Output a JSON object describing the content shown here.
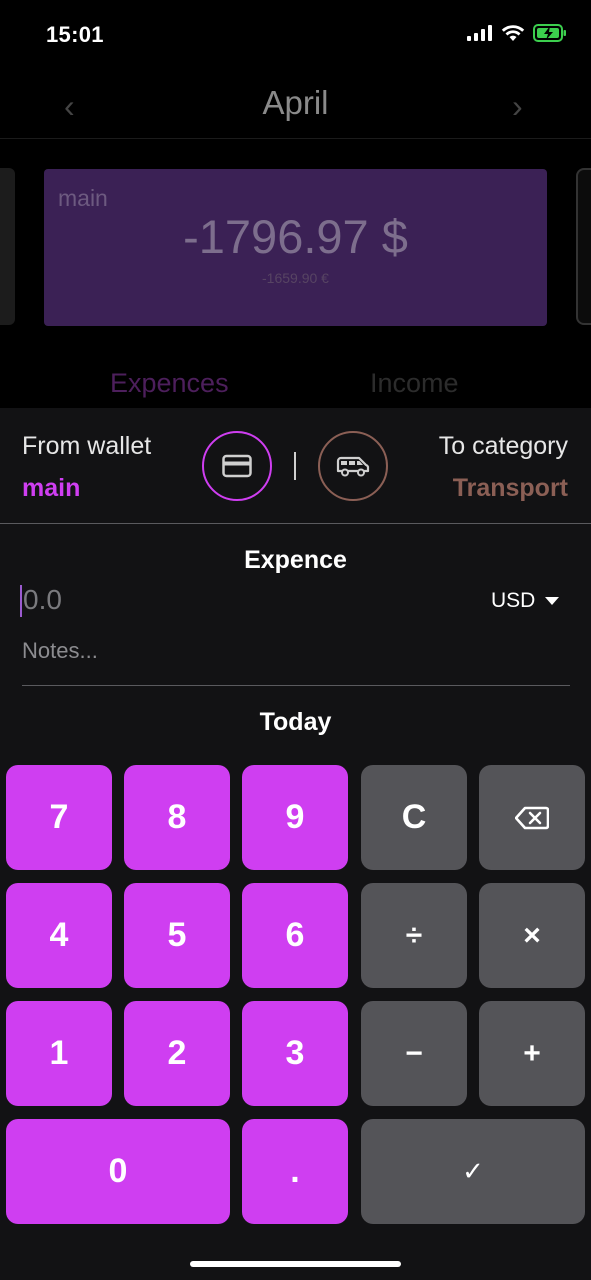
{
  "status": {
    "time": "15:01"
  },
  "header": {
    "title": "April"
  },
  "card": {
    "name": "main",
    "amount": "-1796.97 $",
    "sub_amount": "-1659.90 €"
  },
  "tabs": {
    "expenses": "Expences",
    "income": "Income"
  },
  "sheet": {
    "from_label": "From wallet",
    "from_value": "main",
    "to_label": "To category",
    "to_value": "Transport",
    "title": "Expence",
    "amount_placeholder": "0.0",
    "currency": "USD",
    "notes_placeholder": "Notes...",
    "date": "Today"
  },
  "keypad": {
    "k7": "7",
    "k8": "8",
    "k9": "9",
    "clear": "C",
    "k4": "4",
    "k5": "5",
    "k6": "6",
    "divide": "÷",
    "multiply": "×",
    "k1": "1",
    "k2": "2",
    "k3": "3",
    "minus": "−",
    "plus": "+",
    "k0": "0",
    "dot": ".",
    "confirm": "✓"
  },
  "colors": {
    "accent": "#cf3ef1",
    "category": "#8b5f55",
    "key_gray": "#545458",
    "sheet": "#121214"
  }
}
